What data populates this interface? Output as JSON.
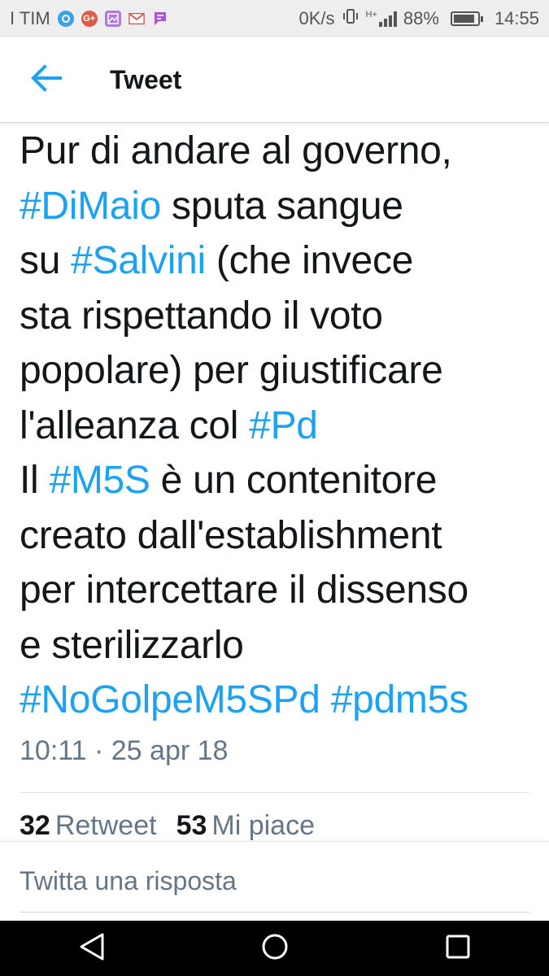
{
  "status_bar": {
    "carrier": "I TIM",
    "speed": "0K/s",
    "network": "H+",
    "battery_text": "88%",
    "battery_level": 0.88,
    "time": "14:55",
    "notification_icons": [
      {
        "name": "circle-app-icon",
        "color": "#3aa0e8"
      },
      {
        "name": "google-plus-icon",
        "color": "#e05a4a"
      },
      {
        "name": "gallery-icon",
        "color": "#b07ad8"
      },
      {
        "name": "gmail-icon",
        "color": "#d9534f"
      },
      {
        "name": "flag-app-icon",
        "color": "#b04fd8"
      }
    ]
  },
  "app_bar": {
    "title": "Tweet",
    "back_icon": "arrow-left-icon"
  },
  "tweet": {
    "lines": [
      [
        {
          "t": "Pur di andare al governo,",
          "h": false
        }
      ],
      [
        {
          "t": "#DiMaio",
          "h": true
        },
        {
          "t": " sputa sangue",
          "h": false
        }
      ],
      [
        {
          "t": "su ",
          "h": false
        },
        {
          "t": "#Salvini",
          "h": true
        },
        {
          "t": " (che invece",
          "h": false
        }
      ],
      [
        {
          "t": "sta rispettando il voto",
          "h": false
        }
      ],
      [
        {
          "t": "popolare) per giustificare",
          "h": false
        }
      ],
      [
        {
          "t": "l'alleanza col ",
          "h": false
        },
        {
          "t": "#Pd",
          "h": true
        }
      ],
      [
        {
          "t": "Il ",
          "h": false
        },
        {
          "t": "#M5S",
          "h": true
        },
        {
          "t": " è un contenitore",
          "h": false
        }
      ],
      [
        {
          "t": "creato dall'establishment",
          "h": false
        }
      ],
      [
        {
          "t": "per intercettare il dissenso",
          "h": false
        }
      ],
      [
        {
          "t": "e sterilizzarlo",
          "h": false
        }
      ],
      [
        {
          "t": "#NoGolpeM5SPd",
          "h": true
        },
        {
          "t": " ",
          "h": false
        },
        {
          "t": "#pdm5s",
          "h": true
        }
      ]
    ],
    "timestamp": "10:11 · 25 apr 18",
    "retweet_count": "32",
    "retweet_label": "Retweet",
    "like_count": "53",
    "like_label": "Mi piace"
  },
  "reply": {
    "placeholder": "Twitta una risposta"
  },
  "nav": {
    "back_icon": "triangle-back-icon",
    "home_icon": "circle-home-icon",
    "recents_icon": "square-recents-icon"
  },
  "colors": {
    "accent": "#1da1f2",
    "text": "#14171a",
    "secondary": "#657786"
  }
}
